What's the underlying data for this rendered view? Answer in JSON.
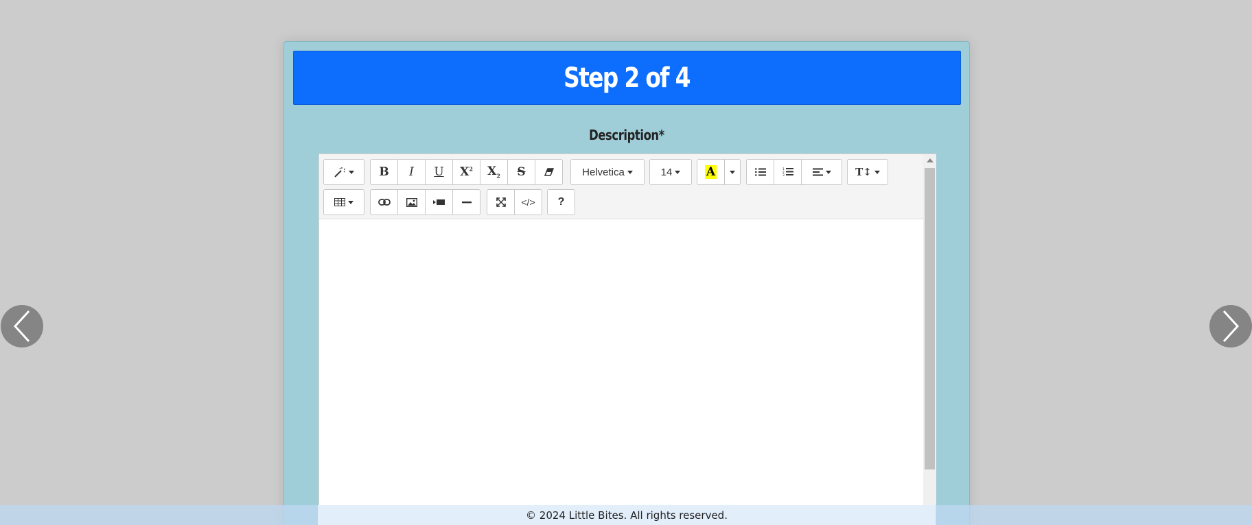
{
  "wizard": {
    "title": "Step 2 of 4",
    "field_label": "Description*"
  },
  "toolbar": {
    "font_family": "Helvetica",
    "font_size": "14",
    "help_label": "?",
    "codeview_label": "</>"
  },
  "icons": {
    "prev": "chevron-left-icon",
    "next": "chevron-right-icon",
    "style": "magic-wand-icon",
    "bold": "bold-icon",
    "italic": "italic-icon",
    "underline": "underline-icon",
    "superscript": "superscript-icon",
    "subscript": "subscript-icon",
    "strikethrough": "strikethrough-icon",
    "eraser": "eraser-icon",
    "highlight": "highlight-color-icon",
    "ul": "unordered-list-icon",
    "ol": "ordered-list-icon",
    "align": "align-left-icon",
    "line_height": "text-height-icon",
    "table": "table-icon",
    "link": "link-icon",
    "picture": "picture-icon",
    "video": "video-icon",
    "hr": "horizontal-rule-icon",
    "fullscreen": "fullscreen-icon",
    "codeview": "code-icon",
    "help": "help-icon"
  },
  "colors": {
    "header_bg": "#0d6efd",
    "card_bg": "#9fcdd8",
    "page_bg": "#cccccc",
    "highlight": "#ffff00"
  },
  "footer": {
    "text": "© 2024 Little Bites. All rights reserved."
  }
}
